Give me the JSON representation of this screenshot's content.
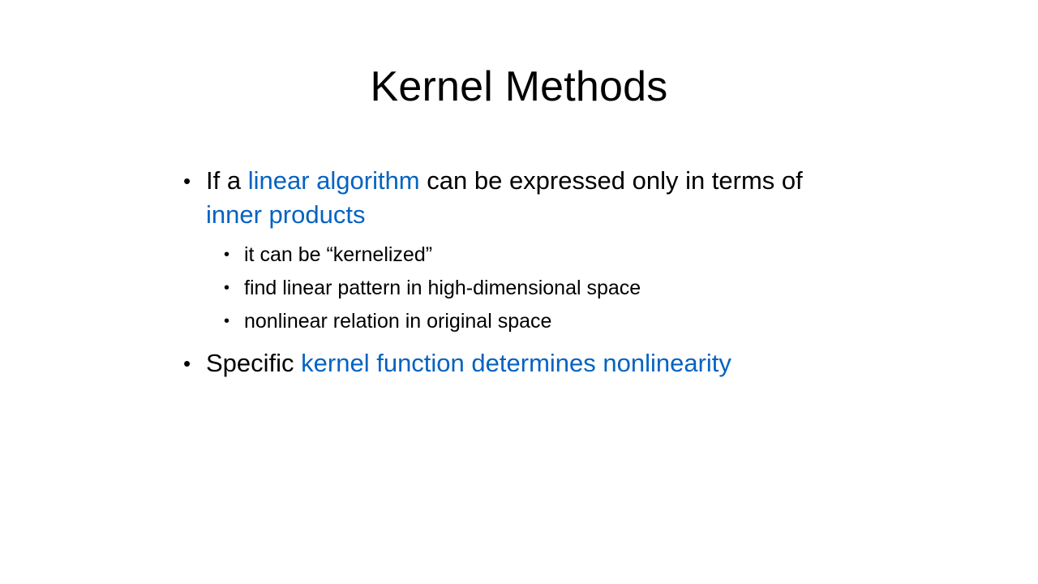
{
  "slide": {
    "title": "Kernel Methods",
    "bullet_1": {
      "part_1": "If a ",
      "part_2": "linear algorithm",
      "part_3": " can be expressed only in terms of ",
      "part_4": "inner products"
    },
    "sub_bullets": [
      "it can be “kernelized”",
      "find linear pattern in high-dimensional space",
      "nonlinear relation in original space"
    ],
    "bullet_2": {
      "part_1": "Specific ",
      "part_2": "kernel function determines nonlinearity"
    }
  },
  "colors": {
    "accent": "#0563C1",
    "text": "#000000",
    "background": "#FFFFFF"
  }
}
